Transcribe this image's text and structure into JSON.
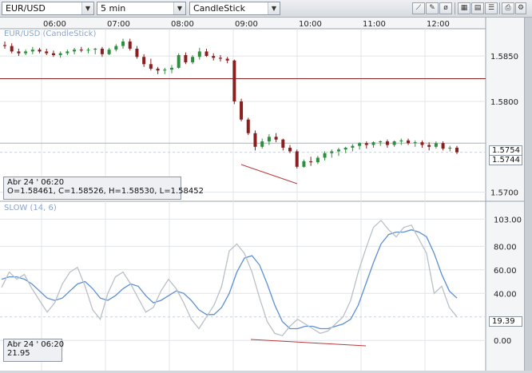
{
  "toolbar": {
    "symbol": "EUR/USD",
    "interval": "5 min",
    "chart_type": "CandleStick",
    "buttons": [
      "draw-line-icon",
      "pencil-icon",
      "erase-icon",
      "table-icon",
      "grid-icon",
      "list-icon",
      "print-icon",
      "settings-icon",
      "close-icon"
    ]
  },
  "price_panel": {
    "title": "EUR/USD (CandleStick)",
    "info_date": "Abr 24 ' 06:20",
    "info_ohlc": "O=1.58461, C=1.58526, H=1.58530, L=1.58452",
    "last_price_tag": "1.5754",
    "cursor_price_tag": "1.5744"
  },
  "osc_panel": {
    "title": "SLOW (14, 6)",
    "info_date": "Abr 24 ' 06:20",
    "info_value": "21.95",
    "value_tag": "19.39"
  },
  "colors": {
    "up": "#2f8f3f",
    "down": "#8b1e1e",
    "fast": "#5b8fd6",
    "slow": "#b9c0c8",
    "trend": "#b83a3a"
  },
  "chart_data": [
    {
      "type": "candlestick",
      "x": [
        "06:00",
        "07:00",
        "08:00",
        "09:00",
        "10:00",
        "11:00",
        "12:00"
      ],
      "ylabels": [
        "1.5850",
        "1.5800",
        "1.5700"
      ],
      "hline": 1.5825,
      "candles": [
        [
          1.5862,
          1.5866,
          1.5858,
          1.5861
        ],
        [
          1.5861,
          1.5864,
          1.5853,
          1.5855
        ],
        [
          1.5855,
          1.5858,
          1.585,
          1.5853
        ],
        [
          1.5853,
          1.5857,
          1.5851,
          1.5855
        ],
        [
          1.5855,
          1.586,
          1.5852,
          1.5857
        ],
        [
          1.5857,
          1.5859,
          1.5853,
          1.5855
        ],
        [
          1.5855,
          1.5858,
          1.5851,
          1.5853
        ],
        [
          1.5853,
          1.5856,
          1.5849,
          1.5851
        ],
        [
          1.5851,
          1.5855,
          1.5848,
          1.5853
        ],
        [
          1.5853,
          1.5857,
          1.5851,
          1.5855
        ],
        [
          1.5855,
          1.5859,
          1.5852,
          1.5857
        ],
        [
          1.5857,
          1.586,
          1.5854,
          1.5856
        ],
        [
          1.5856,
          1.5859,
          1.5853,
          1.5857
        ],
        [
          1.5857,
          1.5859,
          1.5852,
          1.5858
        ],
        [
          1.5858,
          1.586,
          1.5849,
          1.5852
        ],
        [
          1.5852,
          1.5859,
          1.5851,
          1.5857
        ],
        [
          1.5857,
          1.5863,
          1.5855,
          1.5861
        ],
        [
          1.5861,
          1.5869,
          1.5858,
          1.5866
        ],
        [
          1.5866,
          1.5869,
          1.5856,
          1.5858
        ],
        [
          1.5858,
          1.5861,
          1.5847,
          1.5849
        ],
        [
          1.5849,
          1.5852,
          1.5838,
          1.5841
        ],
        [
          1.5841,
          1.5847,
          1.5834,
          1.5836
        ],
        [
          1.5836,
          1.5838,
          1.583,
          1.5834
        ],
        [
          1.5834,
          1.5837,
          1.583,
          1.5835
        ],
        [
          1.5835,
          1.584,
          1.5831,
          1.5837
        ],
        [
          1.5837,
          1.5853,
          1.5836,
          1.5851
        ],
        [
          1.5851,
          1.5854,
          1.5841,
          1.5843
        ],
        [
          1.5843,
          1.5851,
          1.5841,
          1.5849
        ],
        [
          1.5849,
          1.5859,
          1.5846,
          1.5855
        ],
        [
          1.5855,
          1.5858,
          1.5849,
          1.585
        ],
        [
          1.585,
          1.5853,
          1.5845,
          1.5848
        ],
        [
          1.5848,
          1.5851,
          1.5844,
          1.5847
        ],
        [
          1.5847,
          1.5849,
          1.5842,
          1.5845
        ],
        [
          1.5845,
          1.5846,
          1.5797,
          1.58
        ],
        [
          1.58,
          1.5803,
          1.5778,
          1.578
        ],
        [
          1.578,
          1.5782,
          1.5763,
          1.5765
        ],
        [
          1.5765,
          1.5768,
          1.5746,
          1.575
        ],
        [
          1.575,
          1.5759,
          1.5748,
          1.5756
        ],
        [
          1.5756,
          1.5764,
          1.5752,
          1.5761
        ],
        [
          1.5761,
          1.5765,
          1.5755,
          1.5758
        ],
        [
          1.5758,
          1.5759,
          1.5746,
          1.5749
        ],
        [
          1.5749,
          1.5752,
          1.5743,
          1.5745
        ],
        [
          1.5745,
          1.5747,
          1.5726,
          1.5728
        ],
        [
          1.5728,
          1.5736,
          1.5727,
          1.5734
        ],
        [
          1.5734,
          1.5739,
          1.5729,
          1.5733
        ],
        [
          1.5733,
          1.574,
          1.5731,
          1.5738
        ],
        [
          1.5738,
          1.5745,
          1.5735,
          1.5743
        ],
        [
          1.5743,
          1.5747,
          1.5738,
          1.5745
        ],
        [
          1.5745,
          1.5749,
          1.574,
          1.5747
        ],
        [
          1.5747,
          1.575,
          1.5743,
          1.5749
        ],
        [
          1.5749,
          1.5753,
          1.5745,
          1.5751
        ],
        [
          1.5751,
          1.5755,
          1.5747,
          1.5754
        ],
        [
          1.5754,
          1.5756,
          1.5748,
          1.5752
        ],
        [
          1.5752,
          1.5756,
          1.5749,
          1.5755
        ],
        [
          1.5755,
          1.5757,
          1.5751,
          1.5756
        ],
        [
          1.5756,
          1.5758,
          1.5749,
          1.5752
        ],
        [
          1.5752,
          1.5757,
          1.575,
          1.5756
        ],
        [
          1.5756,
          1.5759,
          1.5752,
          1.5757
        ],
        [
          1.5757,
          1.5759,
          1.5752,
          1.5754
        ],
        [
          1.5754,
          1.5757,
          1.575,
          1.5755
        ],
        [
          1.5755,
          1.5757,
          1.5749,
          1.5752
        ],
        [
          1.5752,
          1.5755,
          1.5746,
          1.575
        ],
        [
          1.575,
          1.5756,
          1.5748,
          1.5754
        ],
        [
          1.5754,
          1.5756,
          1.5746,
          1.5748
        ],
        [
          1.5748,
          1.5751,
          1.5745,
          1.5749
        ],
        [
          1.5749,
          1.5751,
          1.5742,
          1.5744
        ]
      ]
    },
    {
      "type": "line",
      "ylabels": [
        "103.00",
        "80.00",
        "60.00",
        "40.00",
        "0.00"
      ],
      "series": [
        {
          "values": [
            45,
            58,
            52,
            56,
            44,
            34,
            24,
            32,
            48,
            58,
            62,
            46,
            26,
            18,
            40,
            54,
            58,
            48,
            36,
            24,
            28,
            42,
            52,
            44,
            32,
            18,
            10,
            20,
            30,
            46,
            76,
            82,
            74,
            58,
            36,
            16,
            6,
            4,
            12,
            18,
            14,
            10,
            6,
            8,
            14,
            20,
            34,
            58,
            78,
            96,
            102,
            94,
            88,
            96,
            98,
            86,
            74,
            40,
            46,
            28,
            20
          ]
        },
        {
          "values": [
            52,
            54,
            54,
            52,
            48,
            42,
            36,
            34,
            36,
            42,
            48,
            50,
            44,
            36,
            34,
            38,
            44,
            48,
            46,
            38,
            32,
            34,
            38,
            42,
            40,
            34,
            26,
            22,
            22,
            28,
            40,
            58,
            70,
            72,
            64,
            48,
            30,
            16,
            10,
            10,
            12,
            12,
            10,
            10,
            12,
            14,
            18,
            30,
            48,
            66,
            82,
            90,
            92,
            92,
            94,
            92,
            88,
            74,
            56,
            42,
            36
          ]
        }
      ]
    }
  ]
}
